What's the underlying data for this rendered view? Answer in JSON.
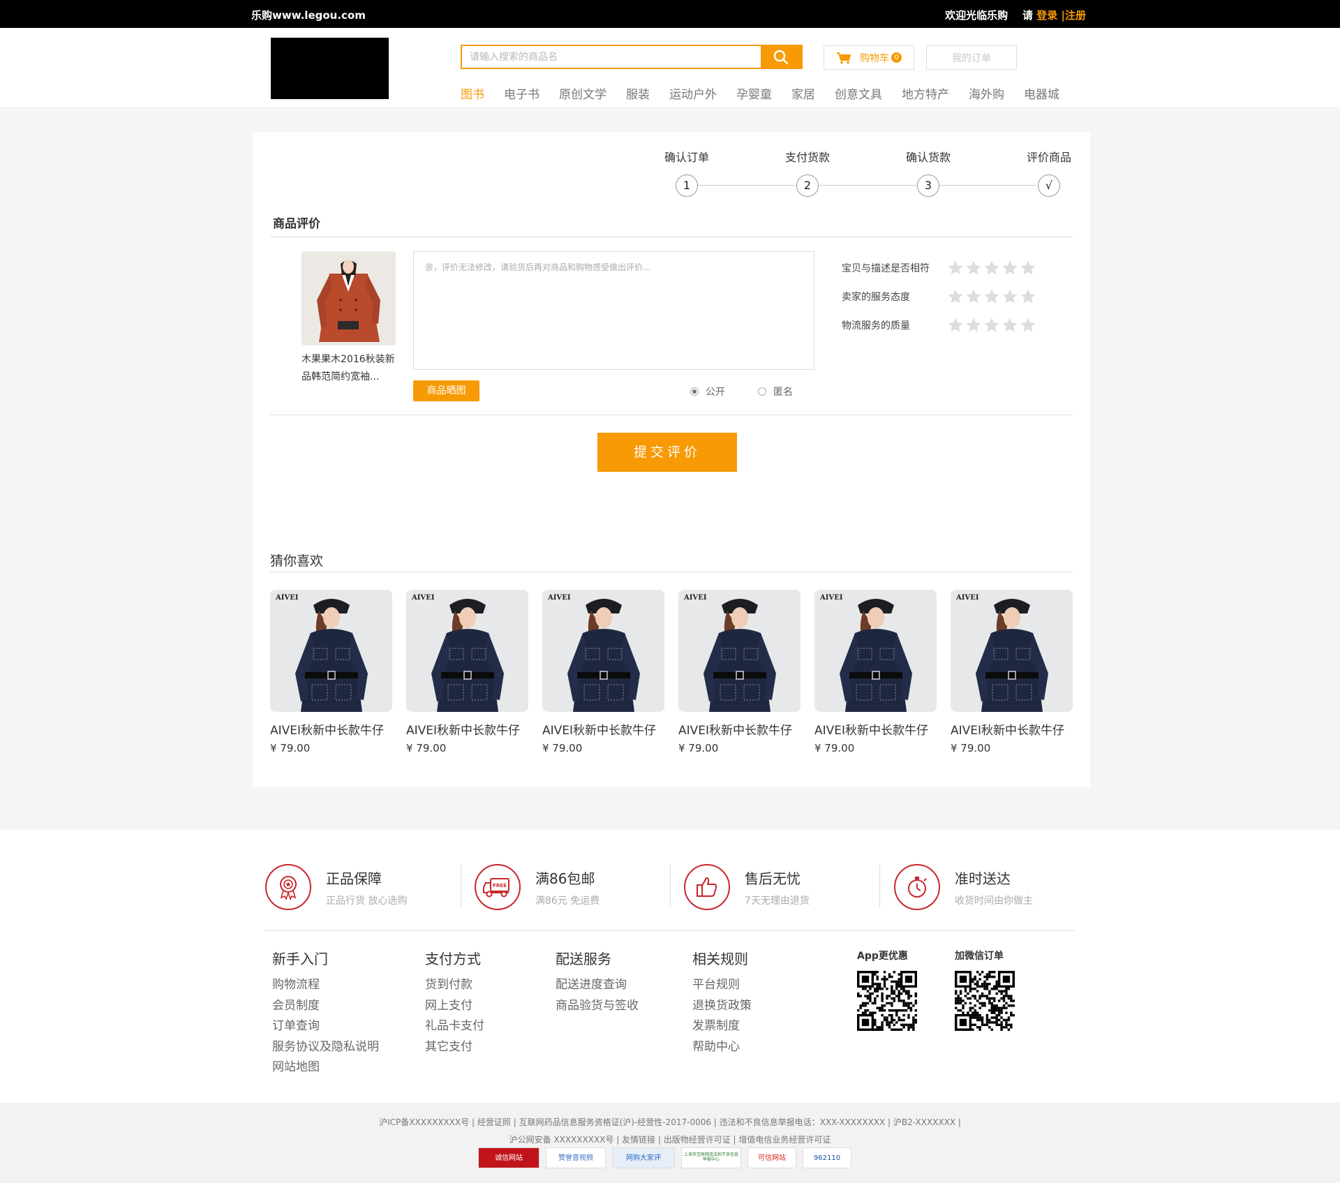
{
  "topbar": {
    "site": "乐购www.legou.com",
    "welcome": "欢迎光临乐购",
    "please": "请",
    "login": "登录",
    "sep": "|",
    "register": "注册"
  },
  "header": {
    "search_placeholder": "请输入搜索的商品名",
    "cart_label": "购物车",
    "cart_count": "0",
    "my_orders": "我的订单",
    "nav": [
      "图书",
      "电子书",
      "原创文学",
      "服装",
      "运动户外",
      "孕婴童",
      "家居",
      "创意文具",
      "地方特产",
      "海外购",
      "电器城"
    ],
    "nav_active": 0
  },
  "steps": [
    {
      "label": "确认订单",
      "mark": "1"
    },
    {
      "label": "支付货款",
      "mark": "2"
    },
    {
      "label": "确认货款",
      "mark": "3"
    },
    {
      "label": "评价商品",
      "mark": "√"
    }
  ],
  "review": {
    "section_title": "商品评价",
    "product_name": "木果果木2016秋装新品韩范简约宽袖...",
    "textarea_placeholder": "亲，评价无法修改，请验货后再对商品和购物感受做出评价...",
    "photo_button": "商品晒图",
    "visibility": [
      {
        "label": "公开",
        "checked": true
      },
      {
        "label": "匿名",
        "checked": false
      }
    ],
    "ratings": [
      {
        "label": "宝贝与描述是否相符",
        "stars": 0
      },
      {
        "label": "卖家的服务态度",
        "stars": 0
      },
      {
        "label": "物流服务的质量",
        "stars": 0
      }
    ],
    "submit": "提交评价"
  },
  "recommend": {
    "title": "猜你喜欢",
    "brand": "AIVEI",
    "items": [
      {
        "name": "AIVEI秋新中长款牛仔",
        "price": "¥ 79.00"
      },
      {
        "name": "AIVEI秋新中长款牛仔",
        "price": "¥ 79.00"
      },
      {
        "name": "AIVEI秋新中长款牛仔",
        "price": "¥ 79.00"
      },
      {
        "name": "AIVEI秋新中长款牛仔",
        "price": "¥ 79.00"
      },
      {
        "name": "AIVEI秋新中长款牛仔",
        "price": "¥ 79.00"
      },
      {
        "name": "AIVEI秋新中长款牛仔",
        "price": "¥ 79.00"
      }
    ]
  },
  "features": [
    {
      "title": "正品保障",
      "sub": "正品行货  放心选购",
      "icon": "medal-icon"
    },
    {
      "title": "满86包邮",
      "sub": "满86元 免运费",
      "icon": "free-shipping-truck-icon"
    },
    {
      "title": "售后无忧",
      "sub": "7天无理由退货",
      "icon": "thumbs-up-icon"
    },
    {
      "title": "准时送达",
      "sub": "收货时间由你做主",
      "icon": "stopwatch-icon"
    }
  ],
  "footer_links": [
    {
      "title": "新手入门",
      "items": [
        "购物流程",
        "会员制度",
        "订单查询",
        "服务协议及隐私说明",
        "网站地图"
      ]
    },
    {
      "title": "支付方式",
      "items": [
        "货到付款",
        "网上支付",
        "礼品卡支付",
        "其它支付"
      ]
    },
    {
      "title": "配送服务",
      "items": [
        "配送进度查询",
        "商品验货与签收"
      ]
    },
    {
      "title": "相关规则",
      "items": [
        "平台规则",
        "退换货政策",
        "发票制度",
        "帮助中心"
      ]
    }
  ],
  "qr": [
    {
      "title": "App更优惠"
    },
    {
      "title": "加微信订单"
    }
  ],
  "bottom": {
    "line1": "沪ICP备XXXXXXXXX号 | 经营证照 | 互联网药品信息服务资格证(沪)-经营性-2017-0006 | 违法和不良信息举报电话：XXX-XXXXXXXX | 沪B2-XXXXXXX |",
    "line2": "沪公网安备 XXXXXXXXX号 | 友情链接 | 出版物经营许可证 | 增值电信业务经营许可证",
    "badges": [
      "诚信网站",
      "赞誉音视频",
      "网购大家评",
      "上海市互联网违法和不良信息举报中心",
      "可信网站",
      "962110"
    ]
  },
  "colors": {
    "accent": "#f79a06",
    "footer_red": "#c8262d",
    "star_gray": "#dddddd"
  }
}
